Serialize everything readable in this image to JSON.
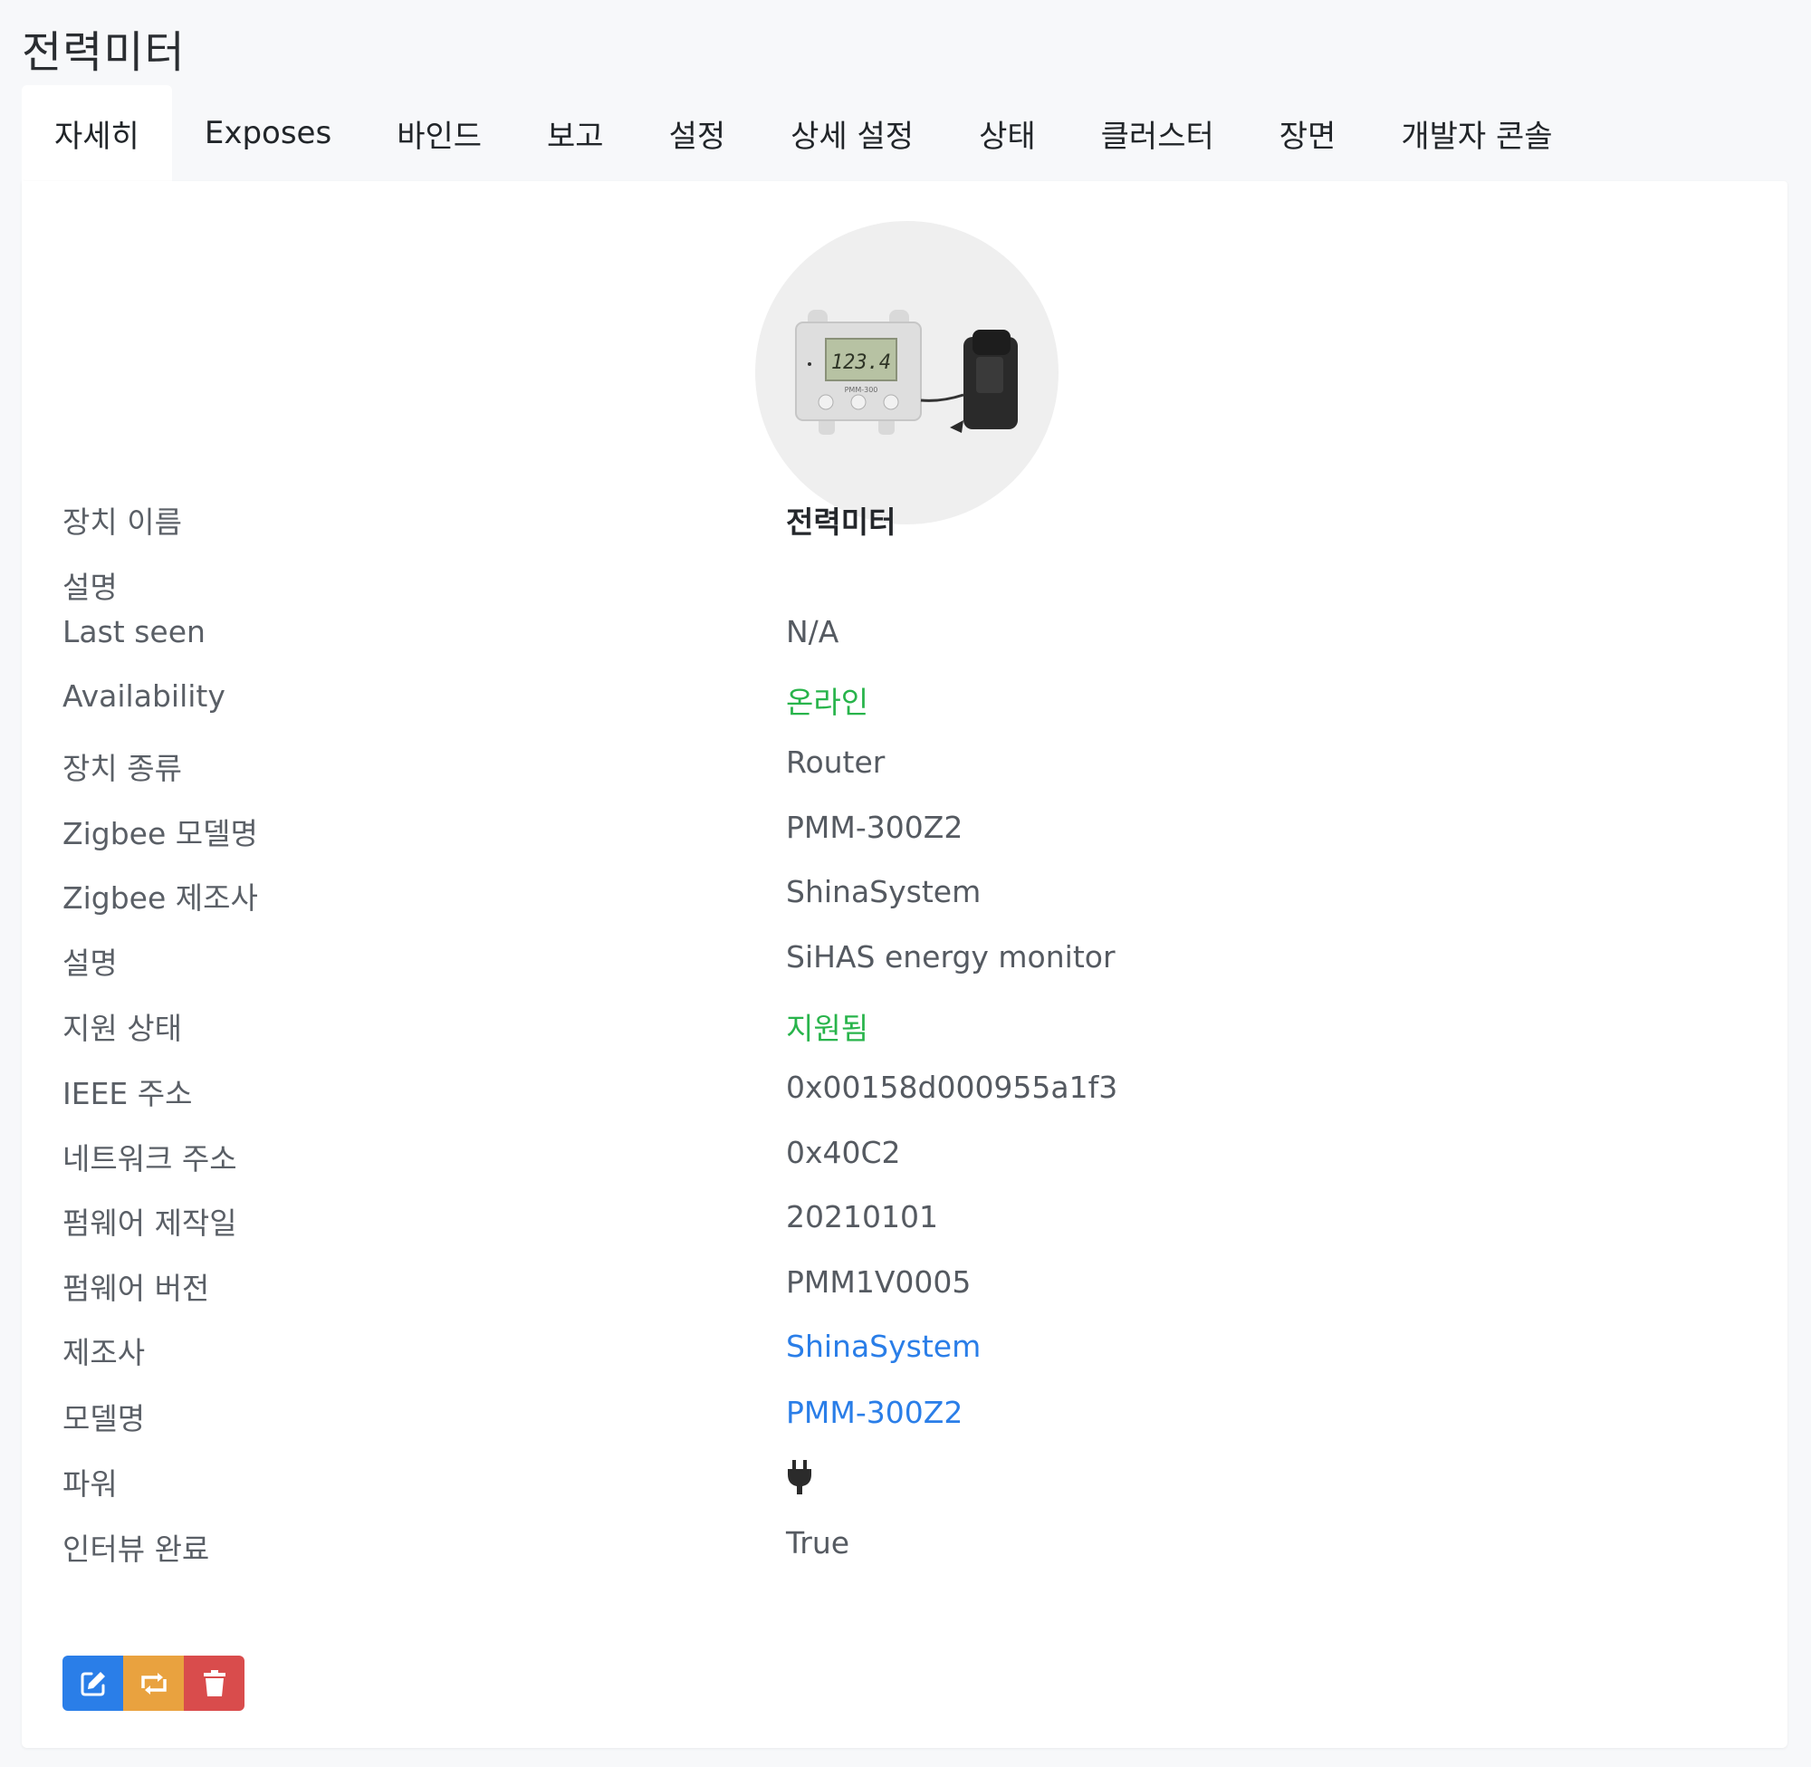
{
  "page": {
    "title": "전력미터"
  },
  "tabs": [
    {
      "label": "자세히",
      "active": true
    },
    {
      "label": "Exposes"
    },
    {
      "label": "바인드"
    },
    {
      "label": "보고"
    },
    {
      "label": "설정"
    },
    {
      "label": "상세 설정"
    },
    {
      "label": "상태"
    },
    {
      "label": "클러스터"
    },
    {
      "label": "장면"
    },
    {
      "label": "개발자 콘솔"
    }
  ],
  "device_image": {
    "display_text": "123.4",
    "model_text": "PMM-300"
  },
  "details": [
    {
      "label": "장치 이름",
      "value": "전력미터"
    },
    {
      "label": "설명",
      "value": ""
    },
    {
      "label": "Last seen",
      "value": "N/A"
    },
    {
      "label": "Availability",
      "value": "온라인"
    },
    {
      "label": "장치 종류",
      "value": "Router"
    },
    {
      "label": "Zigbee 모델명",
      "value": "PMM-300Z2"
    },
    {
      "label": "Zigbee 제조사",
      "value": "ShinaSystem"
    },
    {
      "label": "설명",
      "value": "SiHAS energy monitor"
    },
    {
      "label": "지원 상태",
      "value": "지원됨"
    },
    {
      "label": "IEEE 주소",
      "value": "0x00158d000955a1f3"
    },
    {
      "label": "네트워크 주소",
      "value": "0x40C2"
    },
    {
      "label": "펌웨어 제작일",
      "value": "20210101"
    },
    {
      "label": "펌웨어 버전",
      "value": "PMM1V0005"
    },
    {
      "label": "제조사",
      "value": "ShinaSystem"
    },
    {
      "label": "모델명",
      "value": "PMM-300Z2"
    },
    {
      "label": "파워",
      "value": "",
      "icon": "plug-icon"
    },
    {
      "label": "인터뷰 완료",
      "value": "True"
    }
  ],
  "actions": [
    {
      "icon": "edit-icon",
      "color": "#2a7ee8"
    },
    {
      "icon": "reconfigure-icon",
      "color": "#e9a23f"
    },
    {
      "icon": "trash-icon",
      "color": "#d94c4c"
    }
  ],
  "colors": {
    "online": "#28b44b",
    "link": "#2a7ee8"
  }
}
